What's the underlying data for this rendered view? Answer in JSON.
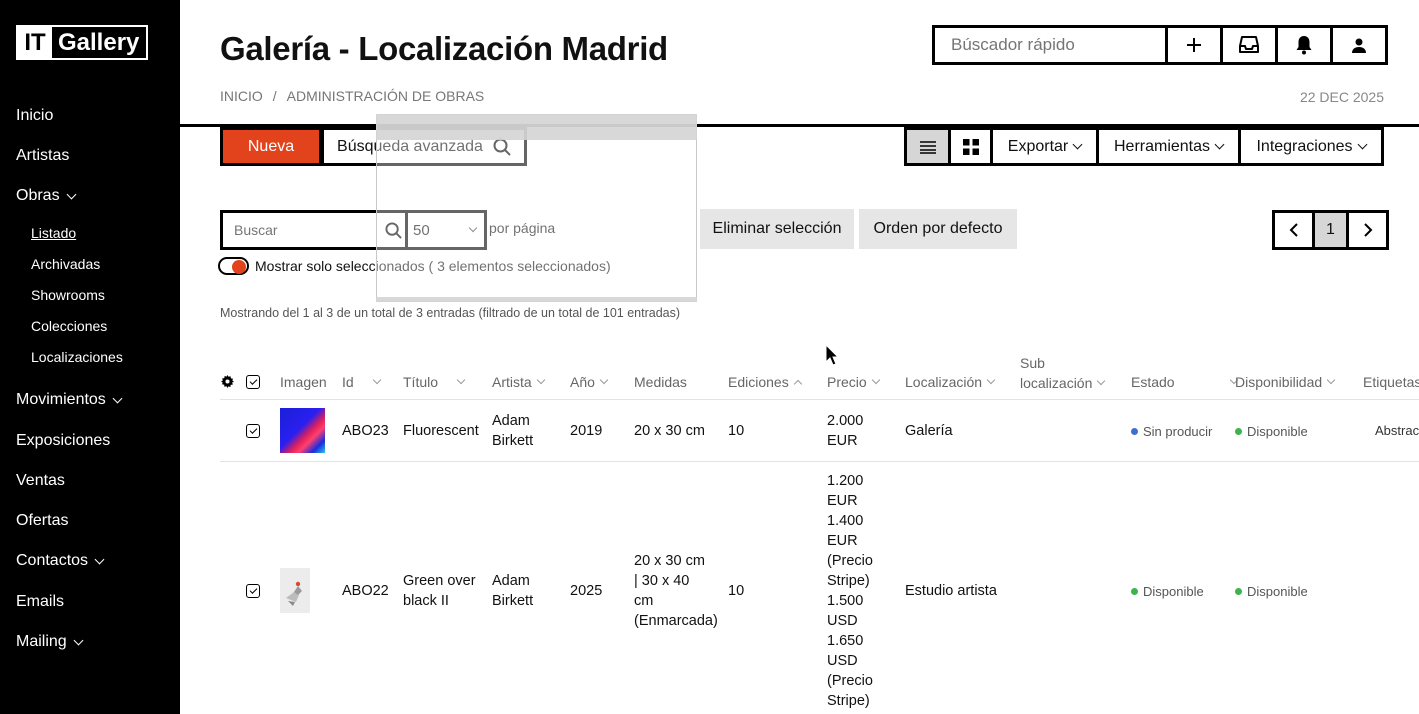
{
  "logo": {
    "it": "IT",
    "gallery": "Gallery"
  },
  "sidebar": {
    "items": [
      {
        "label": "Inicio"
      },
      {
        "label": "Artistas"
      },
      {
        "label": "Obras"
      },
      {
        "label": "Movimientos"
      },
      {
        "label": "Exposiciones"
      },
      {
        "label": "Ventas"
      },
      {
        "label": "Ofertas"
      },
      {
        "label": "Contactos"
      },
      {
        "label": "Emails"
      },
      {
        "label": "Mailing"
      }
    ],
    "obras_sub": [
      "Listado",
      "Archivadas",
      "Showrooms",
      "Colecciones",
      "Localizaciones"
    ]
  },
  "header": {
    "title": "Galería - Localización Madrid",
    "breadcrumb": [
      "INICIO",
      "/",
      "ADMINISTRACIÓN DE OBRAS"
    ],
    "date": "22 DEC 2025",
    "quick_search_placeholder": "Búscador rápido"
  },
  "toolbar": {
    "new_label": "Nueva",
    "advanced_label": "Búsqueda avanzada",
    "export_label": "Exportar",
    "tools_label": "Herramientas",
    "integrations_label": "Integraciones"
  },
  "filters": {
    "search_placeholder": "Buscar",
    "per_page_value": "50",
    "per_page_label": "por página",
    "delete_selection": "Eliminar selección",
    "default_order": "Orden por defecto",
    "current_page": "1",
    "toggle_label": "Mostrar solo seleccionados ( 3 elementos seleccionados)",
    "showing": "Mostrando del 1 al 3 de un total de 3 entradas (filtrado de un total de 101 entradas)"
  },
  "table": {
    "headers": {
      "imagen": "Imagen",
      "id": "Id",
      "titulo": "Título",
      "artista": "Artista",
      "ano": "Año",
      "medidas": "Medidas",
      "ediciones": "Ediciones",
      "precio": "Precio",
      "localizacion": "Localización",
      "sub1": "Sub",
      "sub2": "localización",
      "estado": "Estado",
      "disponibilidad": "Disponibilidad",
      "etiquetas": "Etiquetas"
    },
    "rows": [
      {
        "id": "ABO23",
        "titulo": [
          "Fluorescent"
        ],
        "artista": [
          "Adam",
          "Birkett"
        ],
        "ano": "2019",
        "medidas": [
          "20 x 30 cm"
        ],
        "ediciones": "10",
        "precio": [
          "2.000",
          "EUR"
        ],
        "localizacion": "Galería",
        "estado": "Sin producir",
        "disponibilidad": "Disponible",
        "etiquetas": "Abstrac"
      },
      {
        "id": "ABO22",
        "titulo": [
          "Green over",
          "black II"
        ],
        "artista": [
          "Adam",
          "Birkett"
        ],
        "ano": "2025",
        "medidas": [
          "20 x 30 cm",
          "| 30 x 40",
          "cm",
          "(Enmarcada)"
        ],
        "ediciones": "10",
        "precio": [
          "1.200",
          "EUR",
          "1.400",
          "EUR",
          "(Precio",
          "Stripe)",
          "1.500",
          "USD",
          "1.650",
          "USD",
          "(Precio",
          "Stripe)"
        ],
        "localizacion": "Estudio artista",
        "estado": "Disponible",
        "disponibilidad": "Disponible",
        "etiquetas": ""
      }
    ]
  },
  "colors": {
    "accent": "#e2431c",
    "blue_dot": "#3a6fd8",
    "green_dot": "#3bb54a"
  }
}
